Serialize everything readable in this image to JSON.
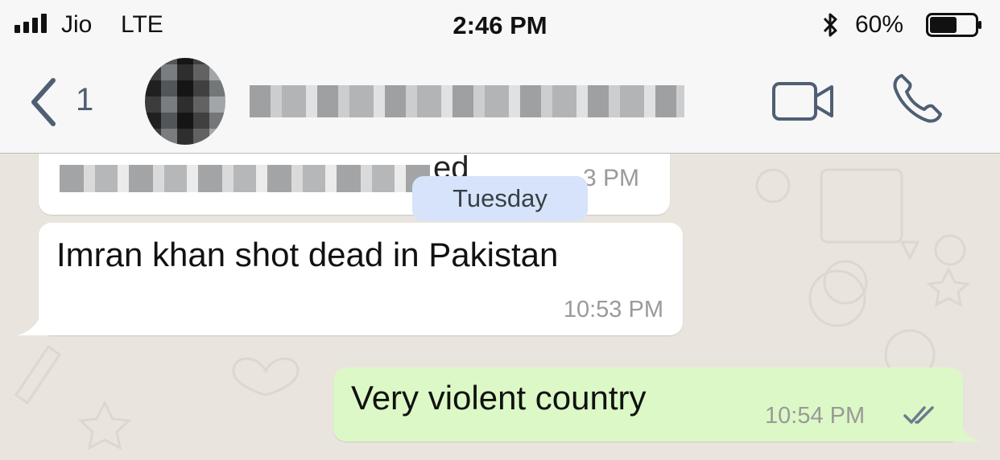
{
  "status_bar": {
    "carrier": "Jio",
    "network": "LTE",
    "time": "2:46 PM",
    "battery_percent": "60%",
    "battery_level": 0.6,
    "icons": [
      "signal-bars-icon",
      "bluetooth-icon",
      "battery-icon"
    ]
  },
  "nav": {
    "back_count": "1",
    "icons": [
      "back-chevron-icon",
      "video-call-icon",
      "phone-call-icon"
    ],
    "accent_color": "#4F5F73"
  },
  "chat": {
    "previous_message": {
      "partial_text": "ed",
      "partial_time": "3 PM"
    },
    "date_separator": "Tuesday",
    "messages": [
      {
        "direction": "incoming",
        "text": "Imran khan shot dead in Pakistan",
        "time": "10:53 PM"
      },
      {
        "direction": "outgoing",
        "text": "Very violent country",
        "time": "10:54 PM",
        "status": "read"
      }
    ],
    "colors": {
      "incoming_bubble": "#FFFFFF",
      "outgoing_bubble": "#DCF8C6",
      "date_chip": "#D6E3FA",
      "background": "#E9E5DE"
    }
  }
}
